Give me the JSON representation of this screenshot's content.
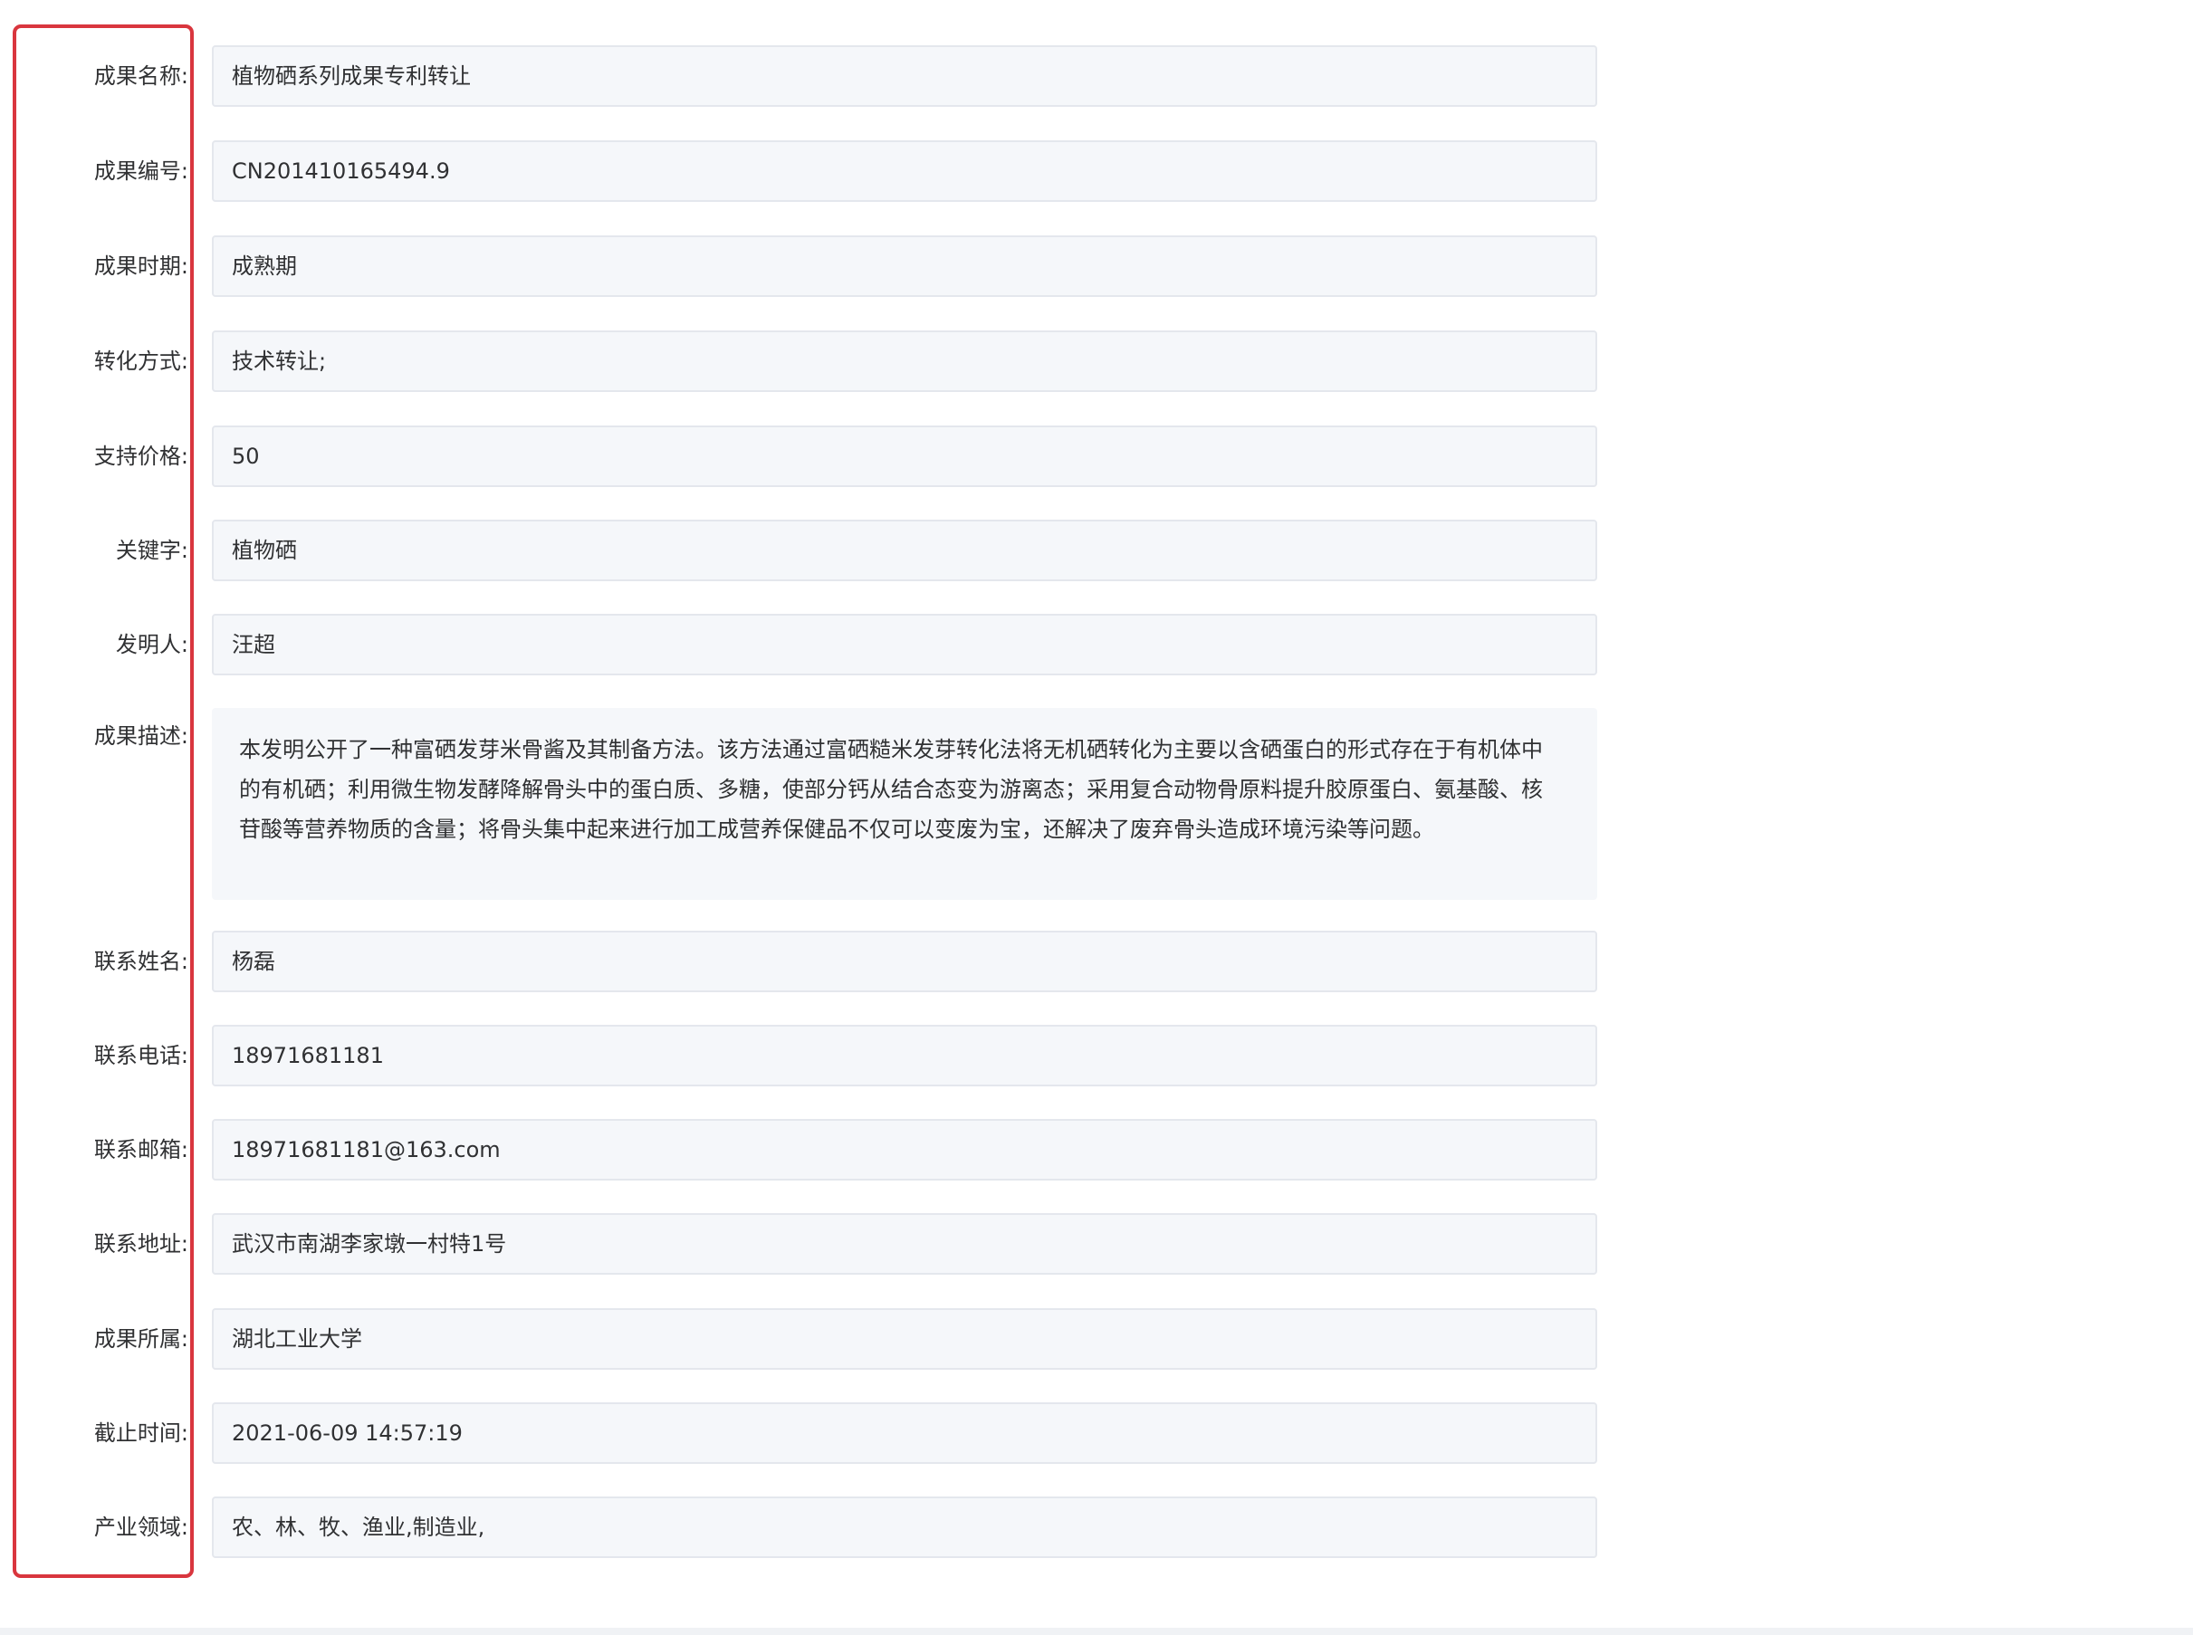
{
  "form": {
    "fields": [
      {
        "label": "成果名称:",
        "value": "植物硒系列成果专利转让"
      },
      {
        "label": "成果编号:",
        "value": "CN201410165494.9"
      },
      {
        "label": "成果时期:",
        "value": "成熟期"
      },
      {
        "label": "转化方式:",
        "value": "技术转让;"
      },
      {
        "label": "支持价格:",
        "value": "50"
      },
      {
        "label": "关键字:",
        "value": "植物硒"
      },
      {
        "label": "发明人:",
        "value": "汪超"
      },
      {
        "label": "成果描述:",
        "value": "本发明公开了一种富硒发芽米骨酱及其制备方法。该方法通过富硒糙米发芽转化法将无机硒转化为主要以含硒蛋白的形式存在于有机体中的有机硒；利用微生物发酵降解骨头中的蛋白质、多糖，使部分钙从结合态变为游离态；采用复合动物骨原料提升胶原蛋白、氨基酸、核苷酸等营养物质的含量；将骨头集中起来进行加工成营养保健品不仅可以变废为宝，还解决了废弃骨头造成环境污染等问题。"
      },
      {
        "label": "联系姓名:",
        "value": "杨磊"
      },
      {
        "label": "联系电话:",
        "value": "18971681181"
      },
      {
        "label": "联系邮箱:",
        "value": "18971681181@163.com"
      },
      {
        "label": "联系地址:",
        "value": "武汉市南湖李家墩一村特1号"
      },
      {
        "label": "成果所属:",
        "value": "湖北工业大学"
      },
      {
        "label": "截止时间:",
        "value": "2021-06-09 14:57:19"
      },
      {
        "label": "产业领域:",
        "value": "农、林、牧、渔业,制造业,"
      }
    ]
  },
  "colors": {
    "highlight_border": "#d9363e",
    "field_background": "#f5f7fa",
    "field_border": "#e4e7ed",
    "text": "#303133"
  }
}
